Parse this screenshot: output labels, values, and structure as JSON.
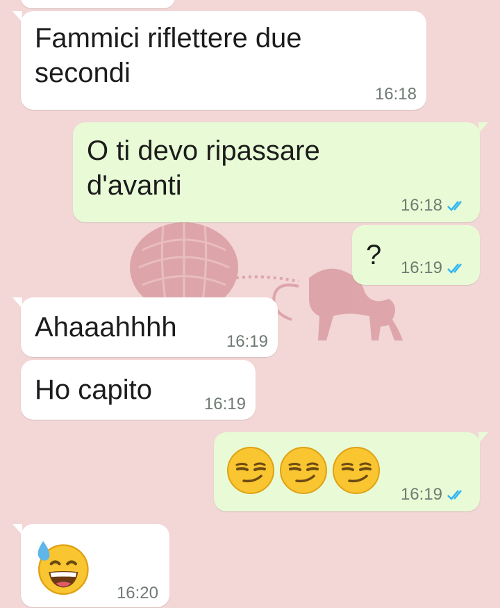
{
  "messages": [
    {
      "id": "m0",
      "direction": "incoming",
      "text": "",
      "time": "",
      "partial": true
    },
    {
      "id": "m1",
      "direction": "incoming",
      "text": "Fammici riflettere due\nsecondi",
      "time": "16:18"
    },
    {
      "id": "m2",
      "direction": "outgoing",
      "text": "O ti devo ripassare\nd'avanti",
      "time": "16:18",
      "status": "read"
    },
    {
      "id": "m3",
      "direction": "outgoing",
      "text": "?",
      "time": "16:19",
      "status": "read"
    },
    {
      "id": "m4",
      "direction": "incoming",
      "text": "Ahaaahhhh",
      "time": "16:19"
    },
    {
      "id": "m5",
      "direction": "incoming",
      "text": "Ho capito",
      "time": "16:19"
    },
    {
      "id": "m6",
      "direction": "outgoing",
      "emoji": [
        "smirking-face-emoji",
        "smirking-face-emoji",
        "smirking-face-emoji"
      ],
      "time": "16:19",
      "status": "read"
    },
    {
      "id": "m7",
      "direction": "incoming",
      "emoji": [
        "grinning-face-with-sweat-emoji"
      ],
      "time": "16:20"
    }
  ],
  "colors": {
    "background": "#f3d6d6",
    "incoming_bubble": "#ffffff",
    "outgoing_bubble": "#e8fbd6",
    "timestamp": "#6f7a73",
    "read_ticks": "#34b7f1",
    "wallpaper_motif": "#d89aa0"
  },
  "wallpaper": {
    "motif": "pumpkin-carriage-and-horse"
  }
}
